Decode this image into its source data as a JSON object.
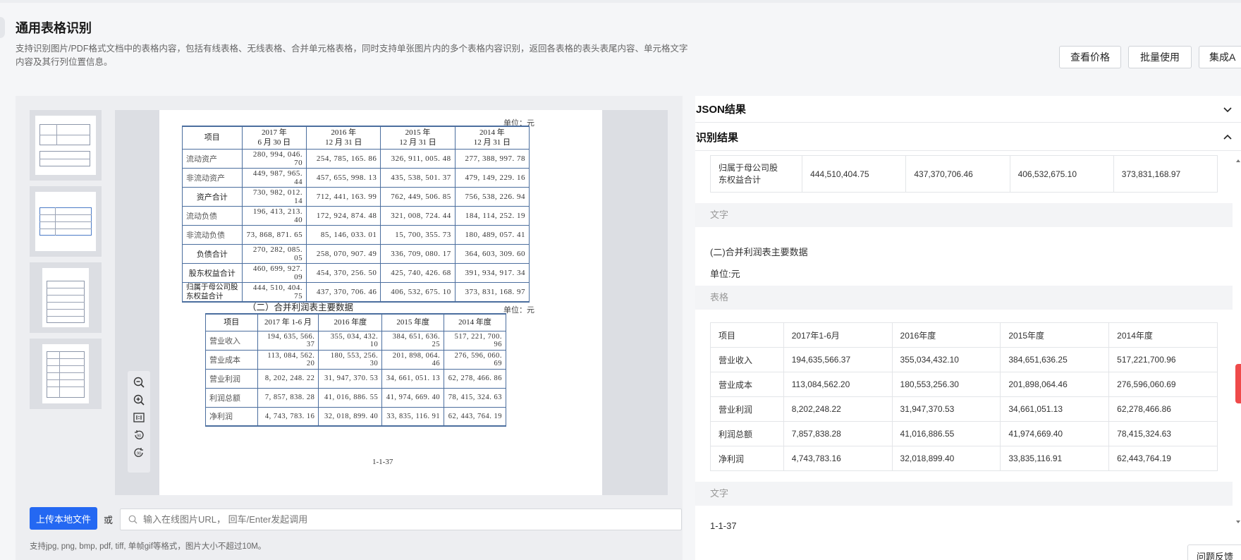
{
  "header": {
    "title": "通用表格识别",
    "description": "支持识别图片/PDF格式文档中的表格内容，包括有线表格、无线表格、合并单元格表格，同时支持单张图片内的多个表格内容识别，返回各表格的表头表尾内容、单元格文字内容及其行列位置信息。",
    "buttons": {
      "price": "查看价格",
      "batch": "批量使用",
      "integrate": "集成A"
    }
  },
  "document": {
    "unit_label": "单位：元",
    "table1": {
      "headers": [
        {
          "l1": "项目",
          "l2": ""
        },
        {
          "l1": "2017 年",
          "l2": "6 月 30 日"
        },
        {
          "l1": "2016 年",
          "l2": "12 月 31 日"
        },
        {
          "l1": "2015 年",
          "l2": "12 月 31 日"
        },
        {
          "l1": "2014 年",
          "l2": "12 月 31 日"
        }
      ],
      "rows": [
        {
          "label": "流动资产",
          "values": [
            "280, 994, 046. 70",
            "254, 785, 165. 86",
            "326, 911, 005. 48",
            "277, 388, 997. 78"
          ]
        },
        {
          "label": "非流动资产",
          "values": [
            "449, 987, 965. 44",
            "457, 655, 998. 13",
            "435, 538, 501. 37",
            "479, 149, 229. 16"
          ]
        },
        {
          "label": "资产合计",
          "values": [
            "730, 982, 012. 14",
            "712, 441, 163. 99",
            "762, 449, 506. 85",
            "756, 538, 226. 94"
          ]
        },
        {
          "label": "流动负债",
          "values": [
            "196, 413, 213. 40",
            "172, 924, 874. 48",
            "321, 008, 724. 44",
            "184, 114, 252. 19"
          ]
        },
        {
          "label": "非流动负债",
          "values": [
            "73, 868, 871. 65",
            "85, 146, 033. 01",
            "15, 700, 355. 73",
            "180, 489, 057. 41"
          ]
        },
        {
          "label": "负债合计",
          "values": [
            "270, 282, 085. 05",
            "258, 070, 907. 49",
            "336, 709, 080. 17",
            "364, 603, 309. 60"
          ]
        },
        {
          "label": "股东权益合计",
          "values": [
            "460, 699, 927. 09",
            "454, 370, 256. 50",
            "425, 740, 426. 68",
            "391, 934, 917. 34"
          ]
        },
        {
          "label": "归属于母公司股东权益合计",
          "values": [
            "444, 510, 404. 75",
            "437, 370, 706. 46",
            "406, 532, 675. 10",
            "373, 831, 168. 97"
          ]
        }
      ]
    },
    "section2_title": "（二）合并利润表主要数据",
    "table2": {
      "headers": [
        "项目",
        "2017 年 1-6 月",
        "2016 年度",
        "2015 年度",
        "2014 年度"
      ],
      "rows": [
        {
          "label": "营业收入",
          "values": [
            "194, 635, 566. 37",
            "355, 034, 432. 10",
            "384, 651, 636. 25",
            "517, 221, 700. 96"
          ]
        },
        {
          "label": "营业成本",
          "values": [
            "113, 084, 562. 20",
            "180, 553, 256. 30",
            "201, 898, 064. 46",
            "276, 596, 060. 69"
          ]
        },
        {
          "label": "营业利润",
          "values": [
            "8, 202, 248. 22",
            "31, 947, 370. 53",
            "34, 661, 051. 13",
            "62, 278, 466. 86"
          ]
        },
        {
          "label": "利润总额",
          "values": [
            "7, 857, 838. 28",
            "41, 016, 886. 55",
            "41, 974, 669. 40",
            "78, 415, 324. 63"
          ]
        },
        {
          "label": "净利润",
          "values": [
            "4, 743, 783. 16",
            "32, 018, 899. 40",
            "33, 835, 116. 91",
            "62, 443, 764. 19"
          ]
        }
      ]
    },
    "page_number": "1-1-37"
  },
  "upload": {
    "button": "上传本地文件",
    "or": "或",
    "url_placeholder": "输入在线图片URL， 回车/Enter发起调用",
    "hint": "支持jpg, png, bmp, pdf, tiff, 单帧gif等格式，图片大小不超过10M。"
  },
  "results": {
    "json_title": "JSON结果",
    "result_title": "识别结果",
    "top_row": {
      "label_l1": "归属于母公司股",
      "label_l2": "东权益合计",
      "values": [
        "444,510,404.75",
        "437,370,706.46",
        "406,532,675.10",
        "373,831,168.97"
      ]
    },
    "text_section_label": "文字",
    "text_line1": "(二)合并利润表主要数据",
    "text_line2": "单位:元",
    "table_section_label": "表格",
    "table": {
      "headers": [
        "项目",
        "2017年1-6月",
        "2016年度",
        "2015年度",
        "2014年度"
      ],
      "rows": [
        [
          "营业收入",
          "194,635,566.37",
          "355,034,432.10",
          "384,651,636.25",
          "517,221,700.96"
        ],
        [
          "营业成本",
          "113,084,562.20",
          "180,553,256.30",
          "201,898,064.46",
          "276,596,060.69"
        ],
        [
          "营业利润",
          "8,202,248.22",
          "31,947,370.53",
          "34,661,051.13",
          "62,278,466.86"
        ],
        [
          "利润总额",
          "7,857,838.28",
          "41,016,886.55",
          "41,974,669.40",
          "78,415,324.63"
        ],
        [
          "净利润",
          "4,743,783.16",
          "32,018,899.40",
          "33,835,116.91",
          "62,443,764.19"
        ]
      ]
    },
    "text_section2_label": "文字",
    "page_text": "1-1-37"
  },
  "feedback": "问题反馈",
  "icons": [
    "zoom-out-icon",
    "zoom-in-icon",
    "actual-size-icon",
    "rotate-left-icon",
    "rotate-right-icon",
    "search-icon",
    "chevron-down-icon",
    "chevron-up-icon"
  ]
}
